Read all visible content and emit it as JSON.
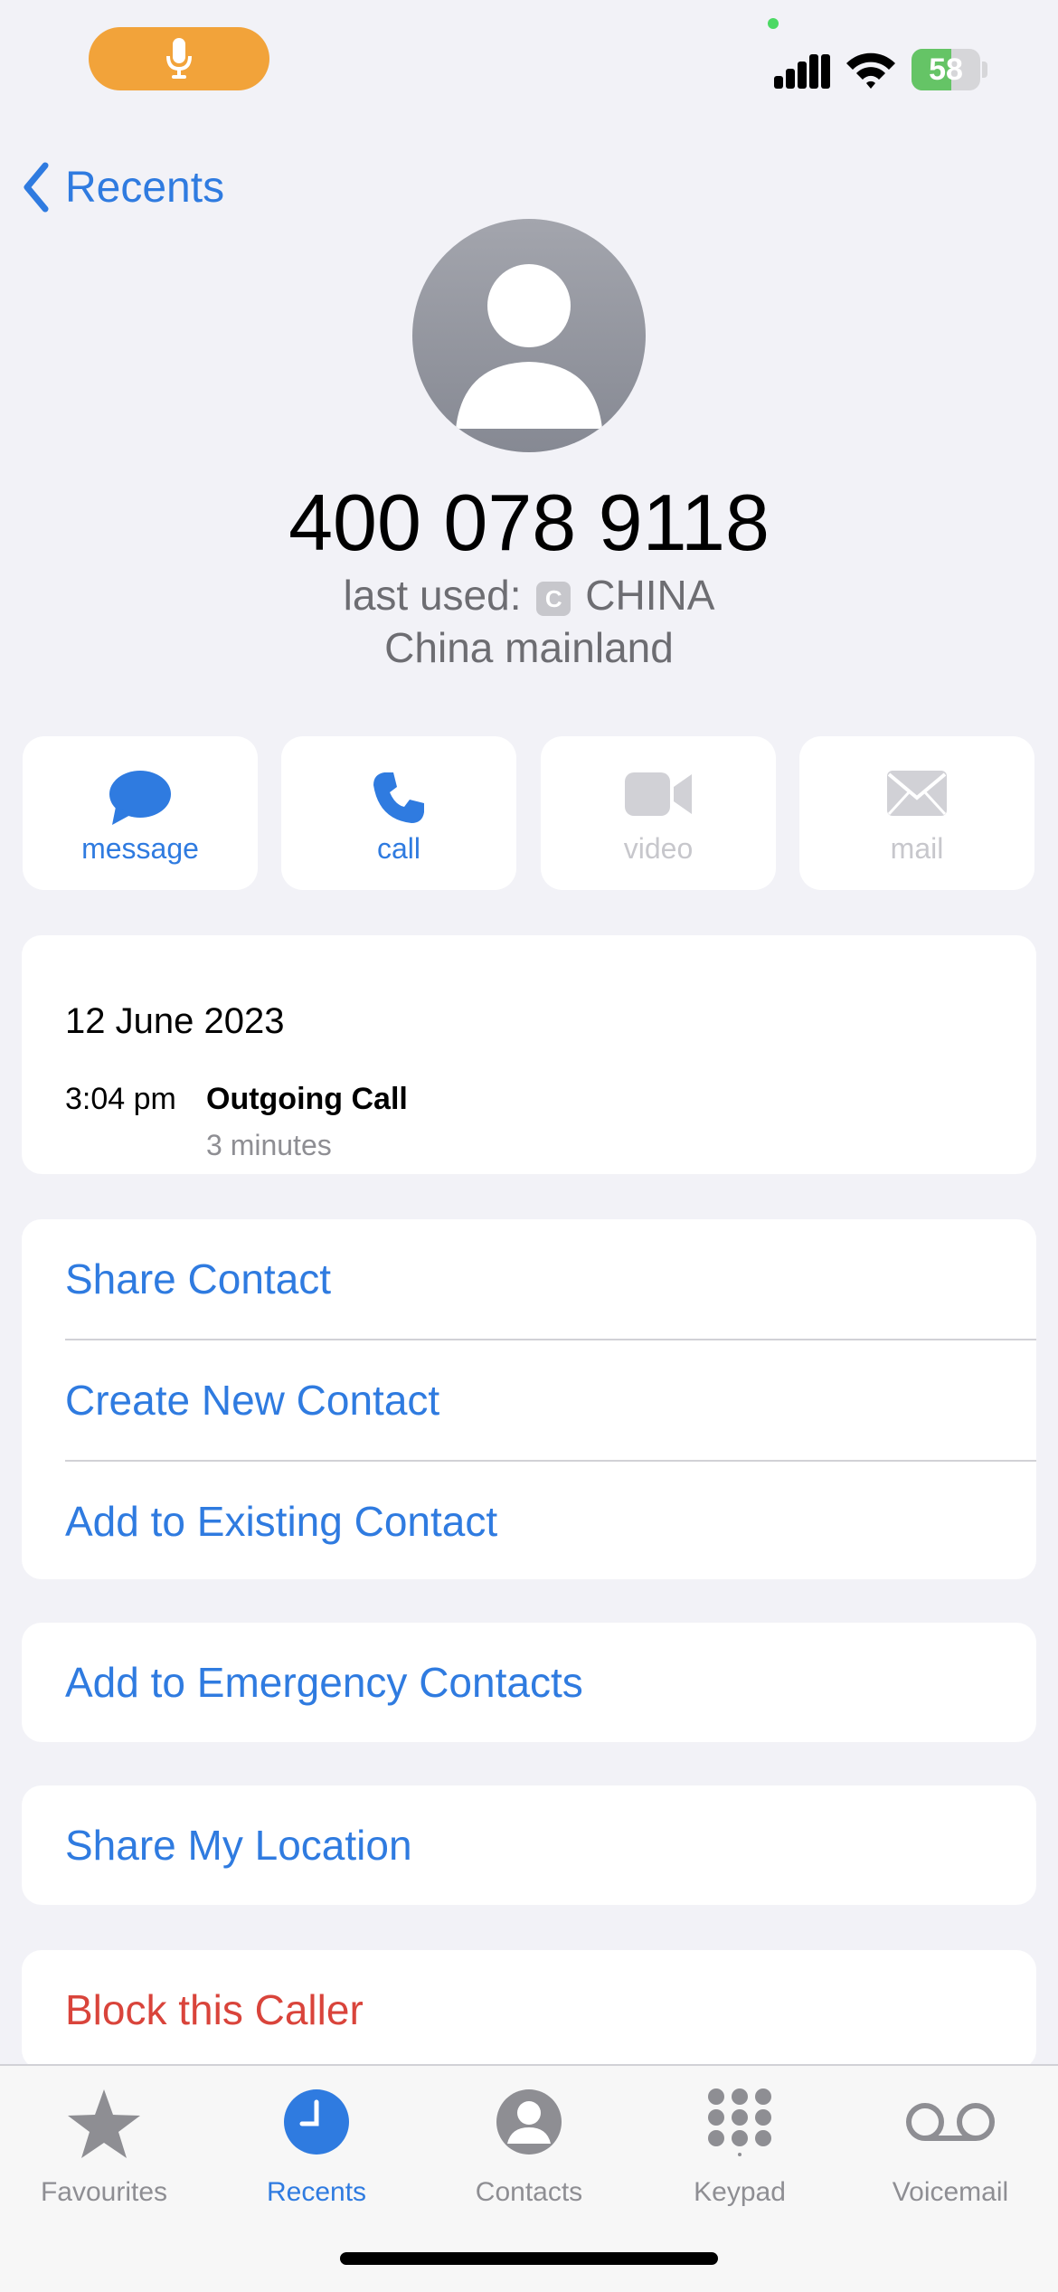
{
  "status_bar": {
    "battery_level": "58",
    "battery_fraction": 0.58,
    "colors": {
      "mic_pill": "#f2a33a",
      "battery": "#65c466"
    },
    "icons": [
      "microphone-icon",
      "cellular-signal-icon",
      "wifi-icon",
      "battery-charging-icon"
    ]
  },
  "nav": {
    "back_label": "Recents"
  },
  "contact": {
    "phone_number": "400 078 9118",
    "last_used_label": "last used:",
    "sim_badge": "C",
    "sim_name": "CHINA",
    "region": "China mainland"
  },
  "actions": [
    {
      "label": "message",
      "icon": "message-bubble-icon",
      "enabled": true
    },
    {
      "label": "call",
      "icon": "phone-icon",
      "enabled": true
    },
    {
      "label": "video",
      "icon": "video-camera-icon",
      "enabled": false
    },
    {
      "label": "mail",
      "icon": "envelope-icon",
      "enabled": false
    }
  ],
  "history": {
    "date": "12 June 2023",
    "time": "3:04 pm",
    "type": "Outgoing Call",
    "duration": "3 minutes"
  },
  "options": {
    "share_contact": "Share Contact",
    "create_new_contact": "Create New Contact",
    "add_to_existing": "Add to Existing Contact",
    "add_emergency": "Add to Emergency Contacts",
    "share_location": "Share My Location",
    "block_caller": "Block this Caller"
  },
  "tabs": [
    {
      "label": "Favourites",
      "icon": "star-icon",
      "active": false
    },
    {
      "label": "Recents",
      "icon": "clock-icon",
      "active": true
    },
    {
      "label": "Contacts",
      "icon": "person-circle-icon",
      "active": false
    },
    {
      "label": "Keypad",
      "icon": "keypad-icon",
      "active": false
    },
    {
      "label": "Voicemail",
      "icon": "voicemail-icon",
      "active": false
    }
  ],
  "colors": {
    "accent": "#2f7be0",
    "destructive": "#d9443b",
    "background": "#f2f2f7"
  }
}
